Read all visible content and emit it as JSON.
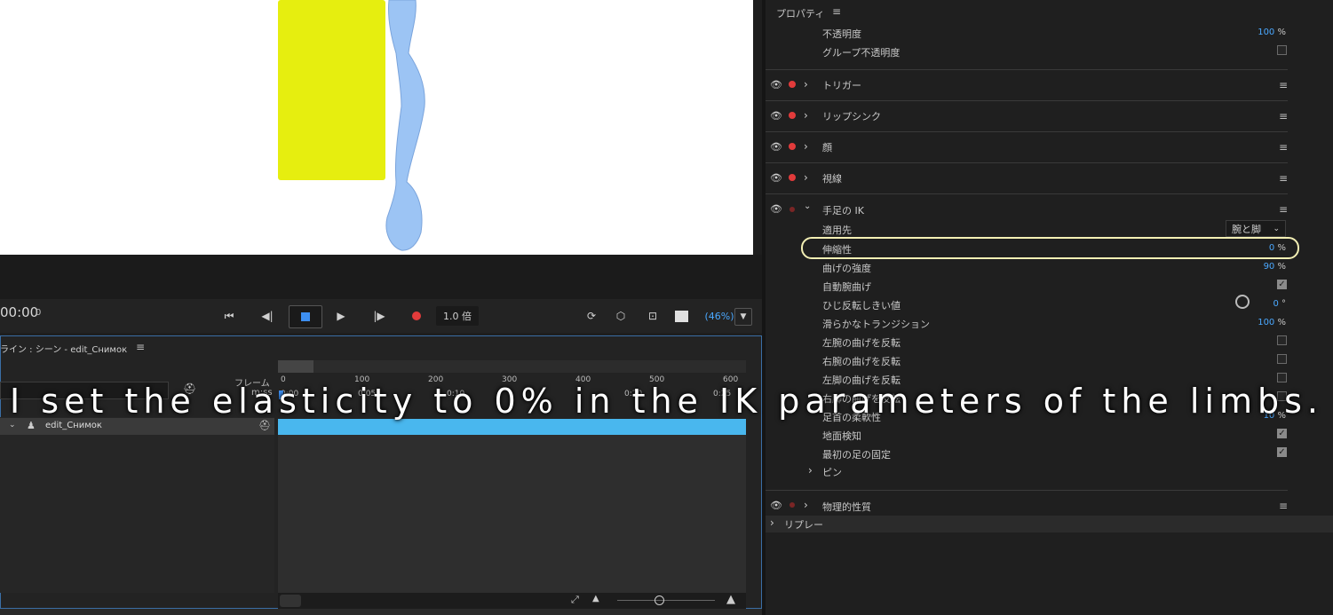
{
  "transport": {
    "timecode": "00:00",
    "frame": "0",
    "speed": "1.0 倍",
    "zoom": "(46%)"
  },
  "timeline": {
    "title": "ライン : シーン - edit_Снимок",
    "frame_label": "フレーム",
    "ms_label": "m:ss",
    "layer_name": "edit_Снимок",
    "ticks_frames": [
      "0",
      "100",
      "200",
      "300",
      "400",
      "500",
      "600"
    ],
    "ticks_time": [
      "0:00",
      "0:05",
      "0:10",
      "0:20",
      "0:25"
    ]
  },
  "panel": {
    "properties_title": "プロパティ",
    "opacity_label": "不透明度",
    "opacity_value": "100",
    "group_opacity_label": "グループ不透明度",
    "sections": [
      {
        "label": "トリガー"
      },
      {
        "label": "リップシンク"
      },
      {
        "label": "顔"
      },
      {
        "label": "視線"
      },
      {
        "label": "手足の IK"
      }
    ],
    "ik": {
      "apply_to_label": "適用先",
      "apply_to_value": "腕と脚",
      "elasticity_label": "伸縮性",
      "elasticity_value": "0",
      "bend_strength_label": "曲げの強度",
      "bend_strength_value": "90",
      "auto_bend_label": "自動腕曲げ",
      "elbow_threshold_label": "ひじ反転しきい値",
      "elbow_threshold_value": "0",
      "smooth_transition_label": "滑らかなトランジション",
      "smooth_transition_value": "100",
      "flip_left_arm_label": "左腕の曲げを反転",
      "flip_right_arm_label": "右腕の曲げを反転",
      "flip_left_leg_label": "左脚の曲げを反転",
      "flip_right_leg_label": "右脚の曲げを反転",
      "foot_flex_label": "足首の柔軟性",
      "foot_flex_value": "10",
      "ground_detect_label": "地面検知",
      "first_foot_fix_label": "最初の足の固定",
      "pin_label": "ピン"
    },
    "physics_label": "物理的性質",
    "replay_label": "リプレー",
    "percent": "%",
    "degree": "°"
  },
  "subtitle": "I set the elasticity to 0% in the IK parameters of the limbs.",
  "colors": {
    "accent_blue": "#4aa8ff",
    "timeline_bar": "#49b7ee",
    "record_red": "#e23b3b",
    "figure_yellow": "#e6ee0f",
    "arm_blue": "#9cc4f4",
    "highlight": "#f3efb4"
  }
}
